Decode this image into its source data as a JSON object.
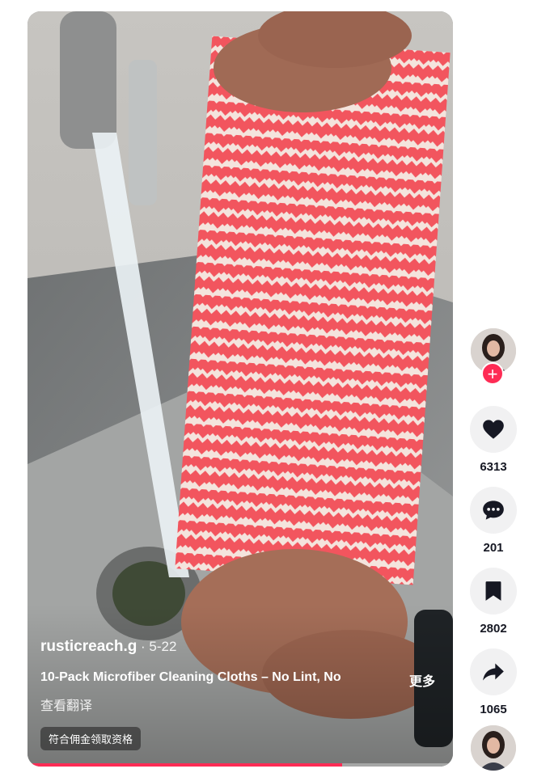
{
  "video": {
    "author": "rusticreach.g",
    "date": " · 5-22",
    "description": "10-Pack Microfiber Cleaning Cloths – No Lint, No",
    "more_label": "更多",
    "translate_label": "查看翻译",
    "badge": "符合佣金领取资格",
    "progress": 0.74,
    "accent_color": "#fe2c55"
  },
  "actions": {
    "follow_icon": "plus-icon",
    "like": {
      "icon": "heart-icon",
      "count": "6313"
    },
    "comment": {
      "icon": "comment-icon",
      "count": "201"
    },
    "save": {
      "icon": "bookmark-icon",
      "count": "2802"
    },
    "share": {
      "icon": "share-icon",
      "count": "1065"
    }
  }
}
